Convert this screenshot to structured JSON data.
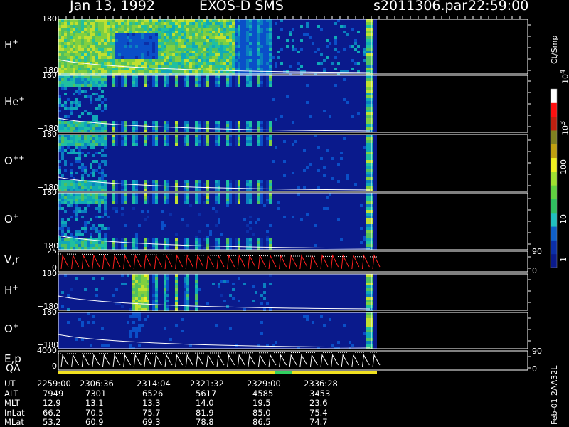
{
  "header": {
    "date": "Jan 13, 1992",
    "instrument": "EXOS-D SMS",
    "file": "s2011306.par",
    "time": "22:59:00"
  },
  "colors": {
    "background": "#000000",
    "field_blue": "#0a1a8c",
    "traces_red": "#ff2020"
  },
  "chart_data": {
    "type": "heatmap",
    "panels": [
      {
        "label_main": "H",
        "label_sup": "+",
        "y_top": "180",
        "y_bottom": "−180",
        "activity": "high"
      },
      {
        "label_main": "He",
        "label_sup": "+",
        "y_top": "180",
        "y_bottom": "−180",
        "activity": "low"
      },
      {
        "label_main": "O",
        "label_sup": "++",
        "y_top": "180",
        "y_bottom": "−180",
        "activity": "low"
      },
      {
        "label_main": "O",
        "label_sup": "+",
        "y_top": "180",
        "y_bottom": "−180",
        "activity": "medium"
      },
      {
        "label_main": "V,r",
        "label_sup": "",
        "y_top": "25",
        "y_bottom": "0",
        "right_top": "90",
        "right_bottom": "0",
        "kind": "line"
      },
      {
        "label_main": "H",
        "label_sup": "+",
        "y_top": "180",
        "y_bottom": "−180",
        "activity": "low2"
      },
      {
        "label_main": "O",
        "label_sup": "+",
        "y_top": "180",
        "y_bottom": "−180",
        "activity": "verylow"
      },
      {
        "label_main": "E,p",
        "label_sup": "",
        "y_top": "4000",
        "y_bottom": "0",
        "right_top": "90",
        "right_bottom": "0",
        "kind": "line"
      }
    ],
    "qa_label": "QA",
    "colorbar": {
      "title": "Ct/Smp",
      "ticks": [
        "1",
        "10",
        "100",
        "10",
        "10"
      ],
      "tick_sups": [
        "",
        "",
        "",
        "3",
        "4"
      ],
      "range": [
        1,
        10000
      ],
      "scale": "log"
    },
    "rows": [
      {
        "name": "UT",
        "values": [
          "2259:00",
          "2306:36",
          "2314:04",
          "2321:32",
          "2329:00",
          "2336:28"
        ]
      },
      {
        "name": "ALT",
        "values": [
          "7949",
          "7301",
          "6526",
          "5617",
          "4585",
          "3453"
        ]
      },
      {
        "name": "MLT",
        "values": [
          "12.9",
          "13.1",
          "13.3",
          "14.0",
          "19.5",
          "23.6"
        ]
      },
      {
        "name": "InLat",
        "values": [
          "66.2",
          "70.5",
          "75.7",
          "81.9",
          "85.0",
          "75.4"
        ]
      },
      {
        "name": "MLat",
        "values": [
          "53.2",
          "60.9",
          "69.3",
          "78.8",
          "86.5",
          "74.7"
        ]
      }
    ],
    "footer_code": "Feb-01 2AA32L"
  }
}
